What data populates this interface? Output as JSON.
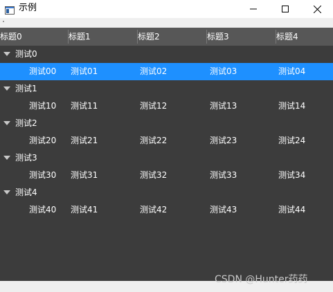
{
  "window": {
    "title": "示例",
    "icon": "app-window-icon",
    "controls": [
      "minimize-icon",
      "maximize-icon",
      "close-icon"
    ]
  },
  "columns": [
    "标题0",
    "标题1",
    "标题2",
    "标题3",
    "标题4"
  ],
  "tree": [
    {
      "label": "测试0",
      "expanded": true,
      "children": [
        [
          "测试00",
          "测试01",
          "测试02",
          "测试03",
          "测试04"
        ]
      ]
    },
    {
      "label": "测试1",
      "expanded": true,
      "children": [
        [
          "测试10",
          "测试11",
          "测试12",
          "测试13",
          "测试14"
        ]
      ]
    },
    {
      "label": "测试2",
      "expanded": true,
      "children": [
        [
          "测试20",
          "测试21",
          "测试22",
          "测试23",
          "测试24"
        ]
      ]
    },
    {
      "label": "测试3",
      "expanded": true,
      "children": [
        [
          "测试30",
          "测试31",
          "测试32",
          "测试33",
          "测试34"
        ]
      ]
    },
    {
      "label": "测试4",
      "expanded": true,
      "children": [
        [
          "测试40",
          "测试41",
          "测试42",
          "测试43",
          "测试44"
        ]
      ]
    }
  ],
  "selected_row": "测试00",
  "colors": {
    "header_bg": "#575757",
    "tree_bg": "#3c3c3c",
    "selection": "#1e90ff",
    "text": "#ffffff"
  },
  "watermark": "CSDN @Hunter药药"
}
